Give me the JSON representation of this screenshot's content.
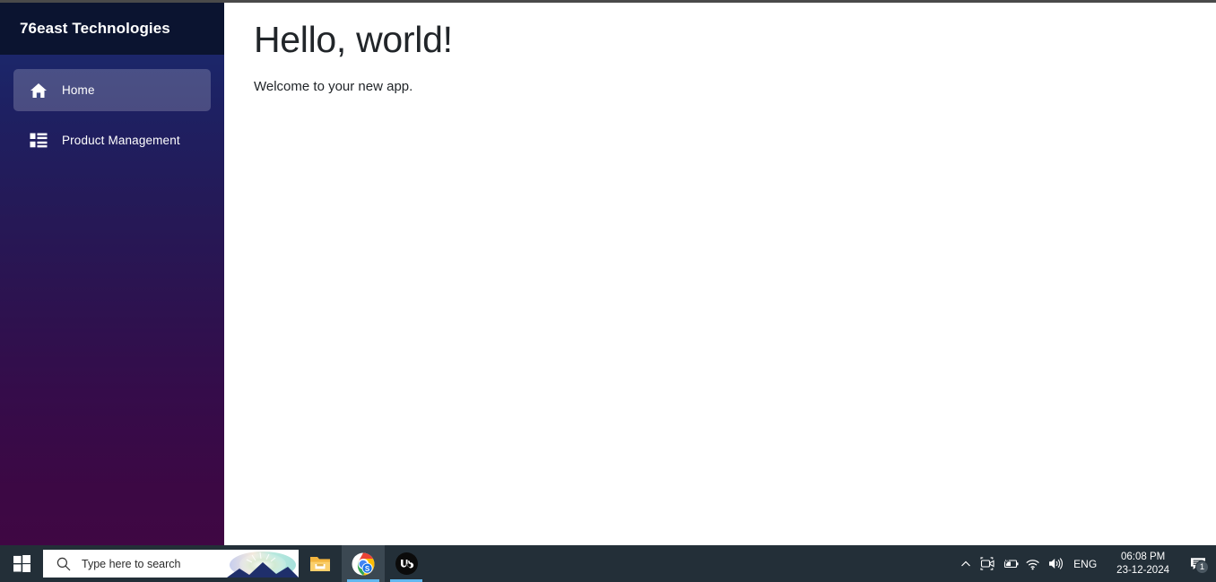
{
  "sidebar": {
    "brand": "76east Technologies",
    "items": [
      {
        "label": "Home",
        "icon": "home-icon",
        "active": true
      },
      {
        "label": "Product Management",
        "icon": "list-view-icon",
        "active": false
      }
    ]
  },
  "main": {
    "title": "Hello, world!",
    "subtitle": "Welcome to your new app."
  },
  "taskbar": {
    "start": "windows-start-icon",
    "search_placeholder": "Type here to search",
    "apps": [
      {
        "name": "file-explorer",
        "running": false
      },
      {
        "name": "google-chrome",
        "running": true
      },
      {
        "name": "upwork",
        "running": true
      }
    ],
    "tray": {
      "show_hidden": "chevron-up-icon",
      "meet_now": "camera-icon",
      "battery": "battery-charging-icon",
      "network": "wifi-icon",
      "volume": "speaker-icon",
      "language": "ENG",
      "time": "06:08 PM",
      "date": "23-12-2024",
      "notifications_icon": "notification-bubble-icon",
      "notifications_count": "1"
    }
  },
  "colors": {
    "sidebar_top": "#1b2d72",
    "sidebar_bottom": "#3f0743",
    "sidebar_header": "#0b1430",
    "active_item": "rgba(255,255,255,0.20)",
    "taskbar": "#232f38",
    "text": "#212529",
    "accent_underline": "#61b8f0"
  }
}
